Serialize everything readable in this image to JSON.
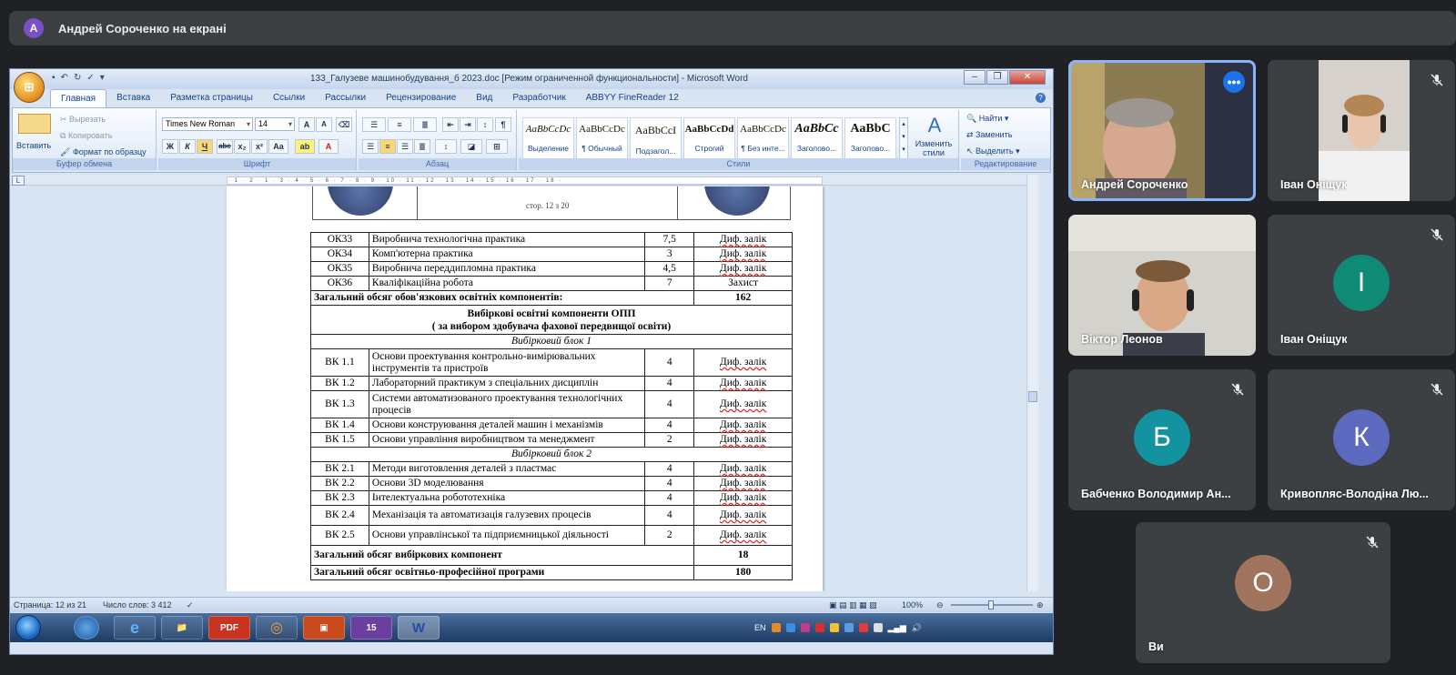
{
  "presenter_bar": {
    "initial": "А",
    "text": "Андрей Сороченко на екрані"
  },
  "word": {
    "title": "133_Галузеве машинобудування_б 2023.doc [Режим ограниченной функциональности] - Microsoft Word",
    "tabs": [
      "Главная",
      "Вставка",
      "Разметка страницы",
      "Ссылки",
      "Рассылки",
      "Рецензирование",
      "Вид",
      "Разработчик",
      "ABBYY FineReader 12"
    ],
    "clipboard": {
      "paste": "Вставить",
      "cut": "Вырезать",
      "copy": "Копировать",
      "format_painter": "Формат по образцу",
      "label": "Буфер обмена"
    },
    "font": {
      "name": "Times New Roman",
      "size": "14",
      "label": "Шрифт",
      "bold": "Ж",
      "italic": "К",
      "underline": "Ч",
      "strike": "abe",
      "sub": "x₂",
      "sup": "x²",
      "case": "Aa",
      "grow": "A",
      "shrink": "A"
    },
    "paragraph": {
      "label": "Абзац"
    },
    "styles": {
      "label": "Стили",
      "items": [
        {
          "sample": "AaBbCcDc",
          "name": "Выделение"
        },
        {
          "sample": "AaBbCcDc",
          "name": "¶ Обычный"
        },
        {
          "sample": "AaBbCcI",
          "name": "Подзагол..."
        },
        {
          "sample": "AaBbCcDd",
          "name": "Строгий"
        },
        {
          "sample": "AaBbCcDc",
          "name": "¶ Без инте..."
        },
        {
          "sample": "AaBbCc",
          "name": "Заголово..."
        },
        {
          "sample": "AaBbC",
          "name": "Заголово..."
        }
      ],
      "change": "Изменить стили"
    },
    "editing": {
      "find": "Найти",
      "replace": "Заменить",
      "select": "Выделить",
      "label": "Редактирование"
    },
    "page_header_text": "стор.  12 з 20",
    "table": {
      "mandatory_rows": [
        {
          "code": "ОК33",
          "name": "Виробнича технологічна практика",
          "credits": "7,5",
          "control": "Диф. залік"
        },
        {
          "code": "ОК34",
          "name": "Комп'ютерна практика",
          "credits": "3",
          "control": "Диф. залік"
        },
        {
          "code": "ОК35",
          "name": "Виробнича переддипломна практика",
          "credits": "4,5",
          "control": "Диф. залік"
        },
        {
          "code": "ОК36",
          "name": "Кваліфікаційна робота",
          "credits": "7",
          "control": "Захист"
        }
      ],
      "mandatory_total_label": "Загальний обсяг обов'язкових освітніх компонентів:",
      "mandatory_total": "162",
      "elective_header_1": "Вибіркові освітні компоненти ОПП",
      "elective_header_2": "( за вибором здобувача фахової передвищої освіти)",
      "block1_label": "Вибірковий блок 1",
      "block1_rows": [
        {
          "code": "ВК 1.1",
          "name": "Основи проектування контрольно-вимірювальних інструментів та пристроїв",
          "credits": "4",
          "control": "Диф. залік"
        },
        {
          "code": "ВК 1.2",
          "name": "Лабораторний практикум з спеціальних дисциплін",
          "credits": "4",
          "control": "Диф. залік"
        },
        {
          "code": "ВК 1.3",
          "name": "Системи автоматизованого проектування технологічних процесів",
          "credits": "4",
          "control": "Диф. залік"
        },
        {
          "code": "ВК 1.4",
          "name": "Основи конструювання деталей машин і механізмів",
          "credits": "4",
          "control": "Диф. залік"
        },
        {
          "code": "ВК 1.5",
          "name": "Основи управління виробництвом та менеджмент",
          "credits": "2",
          "control": "Диф. залік"
        }
      ],
      "block2_label": "Вибірковий блок 2",
      "block2_rows": [
        {
          "code": "ВК 2.1",
          "name": "Методи виготовлення деталей з пластмас",
          "credits": "4",
          "control": "Диф. залік"
        },
        {
          "code": "ВК 2.2",
          "name": "Основи 3D моделювання",
          "credits": "4",
          "control": "Диф. залік"
        },
        {
          "code": "ВК 2.3",
          "name": "Інтелектуальна робототехніка",
          "credits": "4",
          "control": "Диф. залік"
        },
        {
          "code": "ВК 2.4",
          "name": "Механізація та автоматизація галузевих процесів",
          "credits": "4",
          "control": "Диф. залік"
        },
        {
          "code": "ВК 2.5",
          "name": "Основи управлінської та підприємницької діяльності",
          "credits": "2",
          "control": "Диф. залік"
        }
      ],
      "elective_total_label": "Загальний обсяг вибіркових компонент",
      "elective_total": "18",
      "program_total_label": "Загальний обсяг освітньо-професійної програми",
      "program_total": "180"
    },
    "status": {
      "page": "Страница: 12 из 21",
      "words": "Число слов: 3 412",
      "zoom": "100%"
    },
    "taskbar": {
      "lang": "EN",
      "apps": [
        "PDF",
        "15"
      ]
    }
  },
  "participants": [
    {
      "name": "Андрей Сороченко",
      "type": "video",
      "active": true
    },
    {
      "name": "Іван Оніщук",
      "type": "video",
      "muted": true
    },
    {
      "name": "Віктор Леонов",
      "type": "video"
    },
    {
      "name": "Іван Оніщук",
      "type": "avatar",
      "initial": "І",
      "color": "#0f8a74",
      "muted": true
    },
    {
      "name": "Бабченко Володимир Ан...",
      "type": "avatar",
      "initial": "Б",
      "color": "#12939f",
      "muted": true
    },
    {
      "name": "Кривопляс-Володіна Лю...",
      "type": "avatar",
      "initial": "К",
      "color": "#5c6bc0",
      "muted": true
    },
    {
      "name": "Ви",
      "type": "avatar",
      "initial": "О",
      "color": "#a1745d",
      "muted": true
    }
  ],
  "colors": {
    "meet_bg": "#202124",
    "tile_bg": "#3c4043",
    "accent": "#1a73e8"
  }
}
